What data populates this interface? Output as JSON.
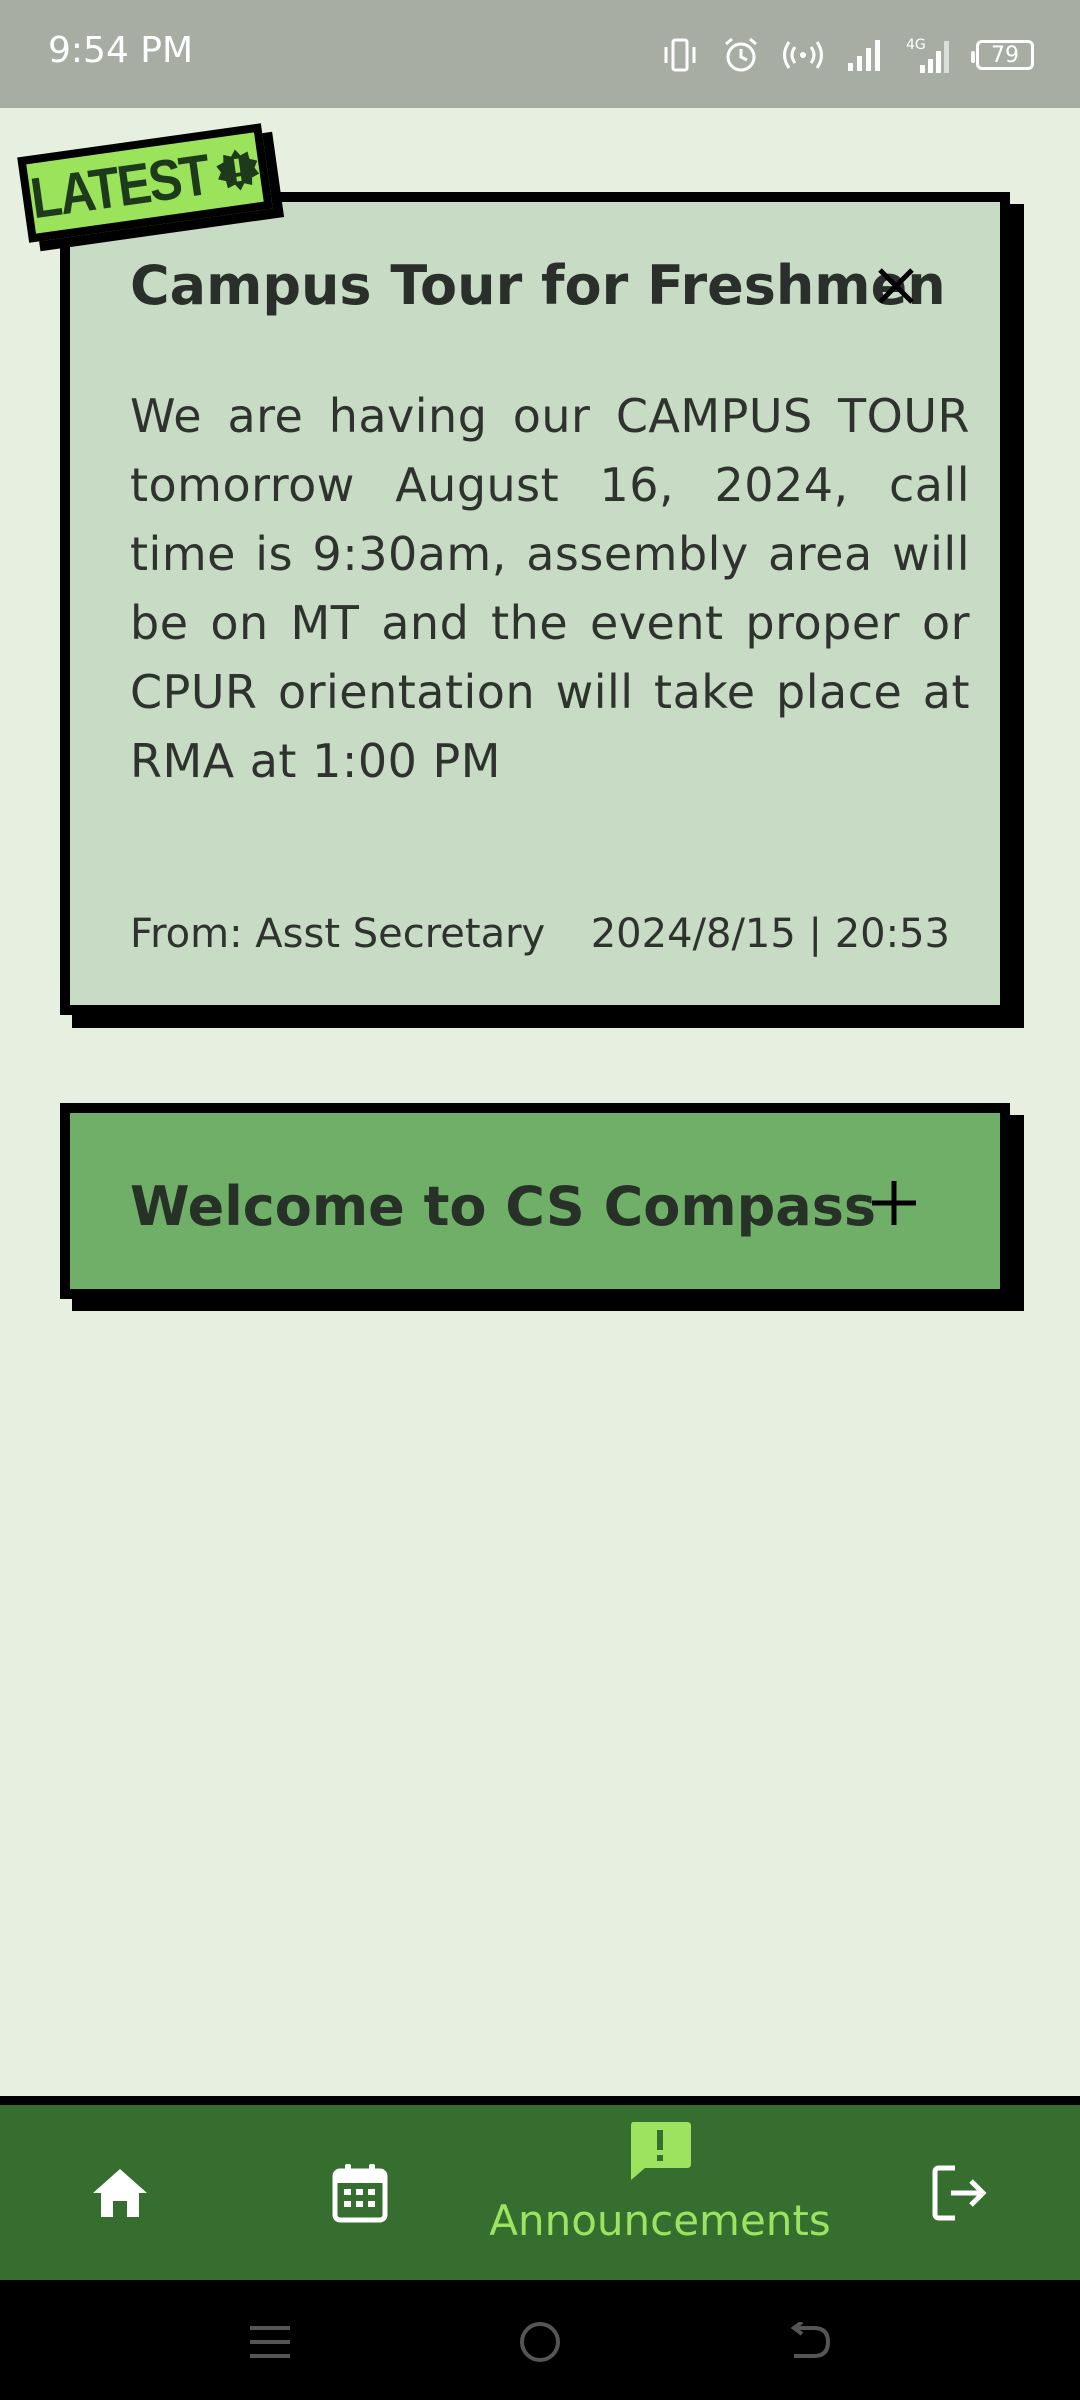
{
  "status_bar": {
    "time": "9:54 PM",
    "battery": "79",
    "network": "4G"
  },
  "badge": {
    "label": "LATEST"
  },
  "announcements": [
    {
      "title": "Campus Tour for Freshmen",
      "body": "We are having our CAMPUS TOUR tomorrow August 16, 2024, call time is 9:30am, assembly area will be on MT and the event proper or CPUR orientation will take place at RMA at 1:00 PM",
      "from": "From: Asst Secretary",
      "datetime": "2024/8/15 | 20:53",
      "expanded": true
    },
    {
      "title": "Welcome to CS Compass",
      "expanded": false
    }
  ],
  "bottom_nav": {
    "items": [
      {
        "icon": "home-icon"
      },
      {
        "icon": "calendar-icon"
      },
      {
        "icon": "announcement-icon",
        "label": "Announcements",
        "active": true
      },
      {
        "icon": "logout-icon"
      }
    ]
  },
  "colors": {
    "background": "#e7efe1",
    "card_expanded": "#c8dcc5",
    "card_collapsed": "#6faf67",
    "nav_bg": "#356e2f",
    "accent": "#9de360"
  }
}
